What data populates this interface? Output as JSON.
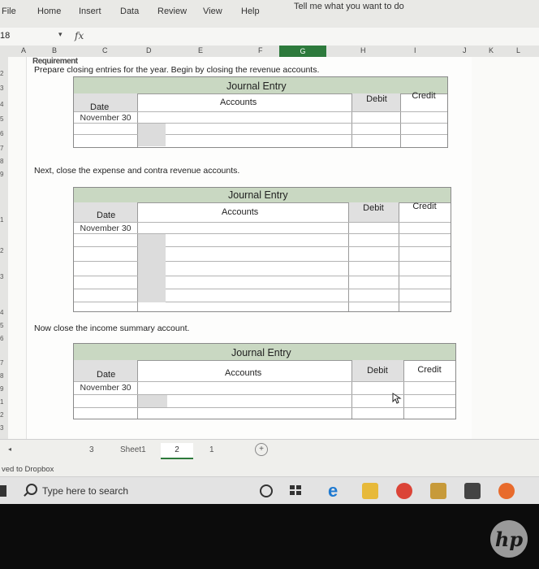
{
  "menu": {
    "items": [
      "File",
      "Home",
      "Insert",
      "Data",
      "Review",
      "View",
      "Help",
      "Tell me what you want to do"
    ]
  },
  "formula_bar": {
    "name_box": "18",
    "fx": "fx"
  },
  "columns": [
    "A",
    "B",
    "C",
    "D",
    "E",
    "F",
    "G",
    "H",
    "I",
    "J",
    "K",
    "L"
  ],
  "active_column": "G",
  "rows": [
    "2",
    "3",
    "4",
    "5",
    "6",
    "7",
    "8",
    "9",
    "1",
    "2",
    "3",
    "4",
    "5",
    "6",
    "7",
    "8",
    "9",
    "1",
    "2",
    "3",
    "4",
    "5",
    "6",
    "7",
    "8",
    "9"
  ],
  "cut_text": "Requirement",
  "instructions": {
    "first": "Prepare closing entries for the year. Begin by closing the revenue accounts.",
    "second": "Next, close the expense and contra revenue accounts.",
    "third": "Now close the income summary account."
  },
  "journal": {
    "title": "Journal Entry",
    "accounts": "Accounts",
    "date": "Date",
    "debit": "Debit",
    "credit": "Credit",
    "date_value": "November 30"
  },
  "tabs": {
    "left_num": "3",
    "sheet1": "Sheet1",
    "active": "2",
    "right_num": "1",
    "add": "+"
  },
  "status": {
    "text": "ved to Dropbox"
  },
  "taskbar": {
    "search_placeholder": "Type here to search"
  },
  "bezel": {
    "logo": "hp"
  },
  "colors": {
    "header_green": "#c9d8c2",
    "active_col": "#2d7a3c",
    "shade": "#dcdcdc"
  }
}
